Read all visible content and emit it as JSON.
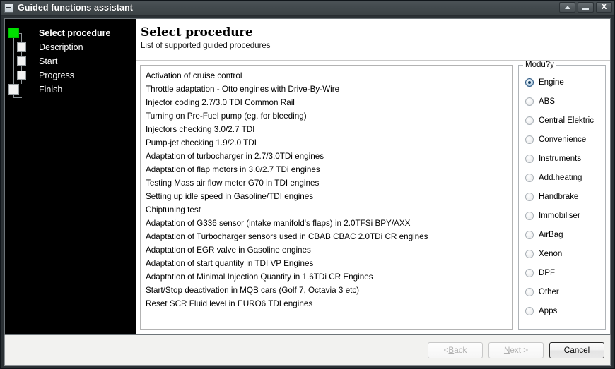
{
  "window": {
    "title": "Guided functions assistant",
    "icon": "window-menu-icon",
    "buttons": {
      "restore": "restore-up",
      "minimize": "minimize",
      "close": "X"
    }
  },
  "sidebar": {
    "steps": [
      {
        "label": "Select procedure",
        "state": "active"
      },
      {
        "label": "Description",
        "state": "pending"
      },
      {
        "label": "Start",
        "state": "pending"
      },
      {
        "label": "Progress",
        "state": "pending"
      },
      {
        "label": "Finish",
        "state": "pending"
      }
    ],
    "active_color": "#00e000"
  },
  "header": {
    "title": "Select procedure",
    "subtitle": "List of supported guided procedures"
  },
  "procedures": [
    "Activation of cruise control",
    "Throttle adaptation - Otto engines with Drive-By-Wire",
    "Injector coding 2.7/3.0 TDI Common Rail",
    "Turning on Pre-Fuel pump (eg. for bleeding)",
    "Injectors checking 3.0/2.7 TDI",
    "Pump-jet checking 1.9/2.0 TDI",
    "Adaptation of turbocharger in 2.7/3.0TDi engines",
    "Adaptation of flap motors in 3.0/2.7 TDi engines",
    "Testing Mass air flow meter G70 in TDI engines",
    "Setting up idle speed in Gasoline/TDI engines",
    "Chiptuning test",
    "Adaptation of G336 sensor (intake manifold's flaps) in 2.0TFSi BPY/AXX",
    "Adaptation of Turbocharger sensors used in CBAB CBAC 2.0TDi CR engines",
    "Adaptation of EGR valve in Gasoline engines",
    "Adaptation of start quantity in TDI VP Engines",
    "Adaptation of Minimal Injection Quantity in 1.6TDi CR Engines",
    "Start/Stop deactivation in MQB cars (Golf 7, Octavia 3 etc)",
    "Reset SCR Fluid level in EURO6 TDI engines"
  ],
  "modules": {
    "legend": "Modu?y",
    "selected": "Engine",
    "options": [
      {
        "label": "Engine",
        "checked": true
      },
      {
        "label": "ABS",
        "checked": false
      },
      {
        "label": "Central Elektric",
        "checked": false
      },
      {
        "label": "Convenience",
        "checked": false
      },
      {
        "label": "Instruments",
        "checked": false
      },
      {
        "label": "Add.heating",
        "checked": false
      },
      {
        "label": "Handbrake",
        "checked": false
      },
      {
        "label": "Immobiliser",
        "checked": false
      },
      {
        "label": "AirBag",
        "checked": false
      },
      {
        "label": "Xenon",
        "checked": false
      },
      {
        "label": "DPF",
        "checked": false
      },
      {
        "label": "Other",
        "checked": false
      },
      {
        "label": "Apps",
        "checked": false
      }
    ]
  },
  "footer": {
    "back": {
      "label": "< Back",
      "mnemonic": "B",
      "enabled": false
    },
    "next": {
      "label": "Next >",
      "mnemonic": "N",
      "enabled": false
    },
    "cancel": {
      "label": "Cancel",
      "enabled": true
    }
  }
}
